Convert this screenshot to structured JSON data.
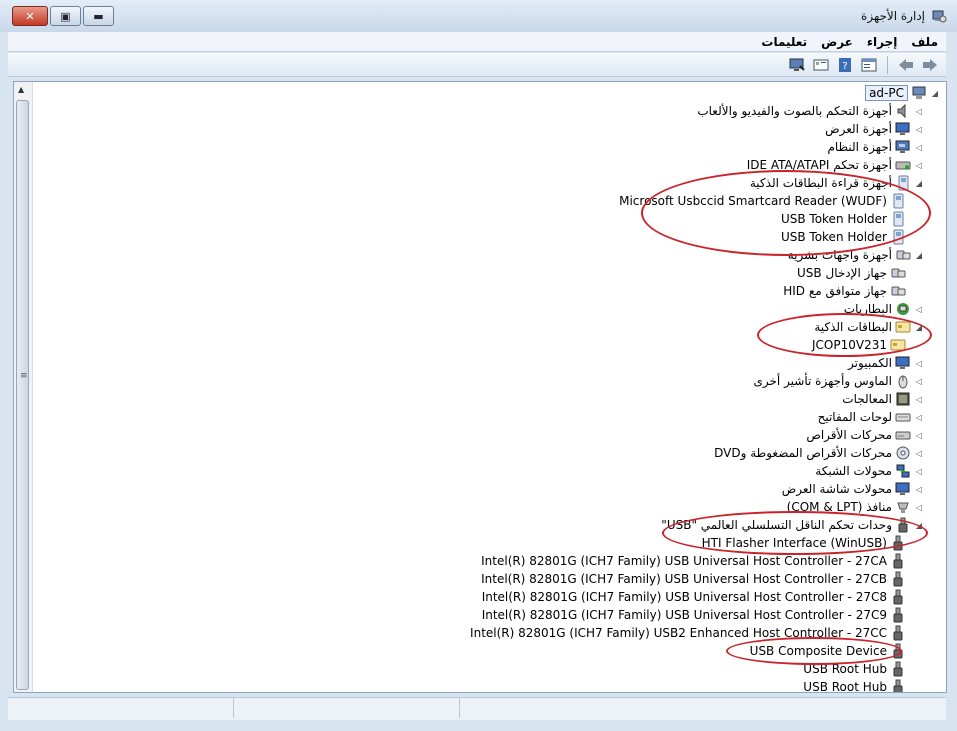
{
  "window": {
    "title": "إدارة الأجهزة",
    "close_glyph": "✕",
    "restore_glyph": "▣",
    "minimize_glyph": "▬"
  },
  "menu": [
    "ملف",
    "إجراء",
    "عرض",
    "تعليمات"
  ],
  "toolbar": [
    "back-icon",
    "forward-icon",
    "properties-icon",
    "help-icon",
    "scan-icon",
    "monitor-icon"
  ],
  "tree": {
    "root": "ad-PC",
    "rows": [
      {
        "label": "أجهزة التحكم بالصوت والفيديو والألعاب",
        "level": 1,
        "icon": "speaker-icon",
        "expander": "◁"
      },
      {
        "label": "أجهزة العرض",
        "level": 1,
        "icon": "display-icon",
        "expander": "◁"
      },
      {
        "label": "أجهزة النظام",
        "level": 1,
        "icon": "system-icon",
        "expander": "◁"
      },
      {
        "label": "أجهزة تحكم IDE ATA/ATAPI",
        "level": 1,
        "icon": "ide-icon",
        "expander": "◁"
      },
      {
        "label": "أجهزة قراءة البطاقات الذكية",
        "level": 1,
        "icon": "card-reader-icon",
        "expander": "◢"
      },
      {
        "label": "Microsoft Usbccid Smartcard Reader (WUDF)",
        "level": 2,
        "icon": "card-reader-icon",
        "expander": ""
      },
      {
        "label": "USB Token Holder",
        "level": 2,
        "icon": "card-reader-icon",
        "expander": ""
      },
      {
        "label": "USB Token Holder",
        "level": 2,
        "icon": "card-reader-icon",
        "expander": ""
      },
      {
        "label": "أجهزة واجهات بشرية",
        "level": 1,
        "icon": "hid-icon",
        "expander": "◢"
      },
      {
        "label": "جهاز الإدخال USB",
        "level": 2,
        "icon": "hid-icon",
        "expander": ""
      },
      {
        "label": "جهاز متوافق مع HID",
        "level": 2,
        "icon": "hid-icon",
        "expander": ""
      },
      {
        "label": "البطاريات",
        "level": 1,
        "icon": "battery-icon",
        "expander": "◁"
      },
      {
        "label": "البطاقات الذكية",
        "level": 1,
        "icon": "smartcard-icon",
        "expander": "◢"
      },
      {
        "label": "JCOP10V231",
        "level": 2,
        "icon": "smartcard-icon",
        "expander": ""
      },
      {
        "label": "الكمبيوتر",
        "level": 1,
        "icon": "computer-icon",
        "expander": "◁"
      },
      {
        "label": "الماوس وأجهزة تأشير أخرى",
        "level": 1,
        "icon": "mouse-icon",
        "expander": "◁"
      },
      {
        "label": "المعالجات",
        "level": 1,
        "icon": "processor-icon",
        "expander": "◁"
      },
      {
        "label": "لوحات المفاتيح",
        "level": 1,
        "icon": "keyboard-icon",
        "expander": "◁"
      },
      {
        "label": "محركات الأقراص",
        "level": 1,
        "icon": "disk-icon",
        "expander": "◁"
      },
      {
        "label": "محركات الأقراص المضغوطة وDVD",
        "level": 1,
        "icon": "dvd-icon",
        "expander": "◁"
      },
      {
        "label": "محولات الشبكة",
        "level": 1,
        "icon": "network-icon",
        "expander": "◁"
      },
      {
        "label": "محولات شاشة العرض",
        "level": 1,
        "icon": "display-icon",
        "expander": "◁"
      },
      {
        "label": "منافذ (COM & LPT)",
        "level": 1,
        "icon": "port-icon",
        "expander": "◁"
      },
      {
        "label": "وحدات تحكم الناقل التسلسلي العالمي \"USB\"",
        "level": 1,
        "icon": "usb-icon",
        "expander": "◢"
      },
      {
        "label": "HTI Flasher Interface (WinUSB)",
        "level": 2,
        "icon": "usb-icon",
        "expander": ""
      },
      {
        "label": "Intel(R) 82801G (ICH7 Family) USB Universal Host Controller - 27CA",
        "level": 2,
        "icon": "usb-icon",
        "expander": ""
      },
      {
        "label": "Intel(R) 82801G (ICH7 Family) USB Universal Host Controller - 27CB",
        "level": 2,
        "icon": "usb-icon",
        "expander": ""
      },
      {
        "label": "Intel(R) 82801G (ICH7 Family) USB Universal Host Controller - 27C8",
        "level": 2,
        "icon": "usb-icon",
        "expander": ""
      },
      {
        "label": "Intel(R) 82801G (ICH7 Family) USB Universal Host Controller - 27C9",
        "level": 2,
        "icon": "usb-icon",
        "expander": ""
      },
      {
        "label": "Intel(R) 82801G (ICH7 Family) USB2 Enhanced Host Controller - 27CC",
        "level": 2,
        "icon": "usb-icon",
        "expander": ""
      },
      {
        "label": "USB Composite Device",
        "level": 2,
        "icon": "usb-icon",
        "expander": ""
      },
      {
        "label": "USB Root Hub",
        "level": 2,
        "icon": "usb-icon",
        "expander": ""
      },
      {
        "label": "USB Root Hub",
        "level": 2,
        "icon": "usb-icon",
        "expander": ""
      }
    ]
  },
  "colors": {
    "highlight_ellipse": "#c8242a",
    "window_bg": "#d9e4f1"
  }
}
